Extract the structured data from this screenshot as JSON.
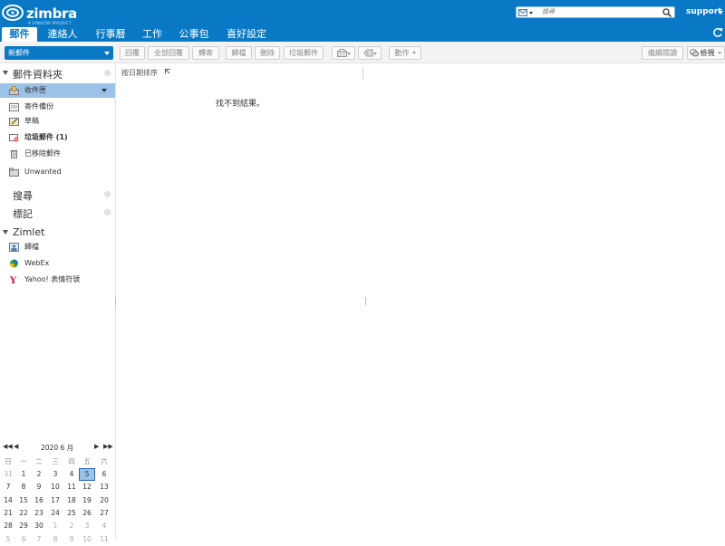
{
  "app": {
    "logo_text": "zimbra",
    "logo_subtext": "A SYNACOR PRODUCT",
    "user_name": "support",
    "search_placeholder": "搜尋"
  },
  "nav_tabs": [
    {
      "label": "郵件",
      "active": true
    },
    {
      "label": "連絡人",
      "active": false
    },
    {
      "label": "行事曆",
      "active": false
    },
    {
      "label": "工作",
      "active": false
    },
    {
      "label": "公事包",
      "active": false
    },
    {
      "label": "喜好設定",
      "active": false
    }
  ],
  "toolbar": {
    "new_label": "新郵件",
    "reply": "回覆",
    "reply_all": "全部回覆",
    "forward": "轉寄",
    "archive": "歸檔",
    "delete": "刪除",
    "spam": "垃圾郵件",
    "actions": "動作",
    "continue_reading": "繼續閱讀",
    "view": "檢視"
  },
  "sidebar": {
    "mail_folders_title": "郵件資料夾",
    "folders": [
      {
        "label": "收件匣",
        "icon": "inbox-icon",
        "selected": true,
        "bold": false
      },
      {
        "label": "寄件備份",
        "icon": "sent-icon",
        "selected": false,
        "bold": false
      },
      {
        "label": "草稿",
        "icon": "drafts-icon",
        "selected": false,
        "bold": false
      },
      {
        "label": "垃圾郵件 (1)",
        "icon": "junk-icon",
        "selected": false,
        "bold": true
      },
      {
        "label": "已移除郵件",
        "icon": "trash-icon",
        "selected": false,
        "bold": false
      },
      {
        "label": "Unwanted",
        "icon": "folder-icon",
        "selected": false,
        "bold": false
      }
    ],
    "search_title": "搜尋",
    "tags_title": "標記",
    "zimlet_title": "Zimlet",
    "zimlets": [
      {
        "label": "歸檔",
        "icon": "archive-zimlet-icon"
      },
      {
        "label": "WebEx",
        "icon": "webex-icon"
      },
      {
        "label": "Yahoo! 表情符號",
        "icon": "yahoo-icon"
      }
    ]
  },
  "mini_calendar": {
    "title": "2020 6 月",
    "weekdays": [
      "日",
      "一",
      "二",
      "三",
      "四",
      "五",
      "六"
    ],
    "weeks": [
      [
        "31",
        "1",
        "2",
        "3",
        "4",
        "5",
        "6"
      ],
      [
        "7",
        "8",
        "9",
        "10",
        "11",
        "12",
        "13"
      ],
      [
        "14",
        "15",
        "16",
        "17",
        "18",
        "19",
        "20"
      ],
      [
        "21",
        "22",
        "23",
        "24",
        "25",
        "26",
        "27"
      ],
      [
        "28",
        "29",
        "30",
        "1",
        "2",
        "3",
        "4"
      ],
      [
        "5",
        "6",
        "7",
        "8",
        "9",
        "10",
        "11"
      ]
    ],
    "today": "5"
  },
  "message_list": {
    "sort_label": "按日期排序",
    "empty_text": "找不到結果。"
  },
  "colors": {
    "brand": "#0a79c5",
    "selection": "#9bc3e8"
  }
}
